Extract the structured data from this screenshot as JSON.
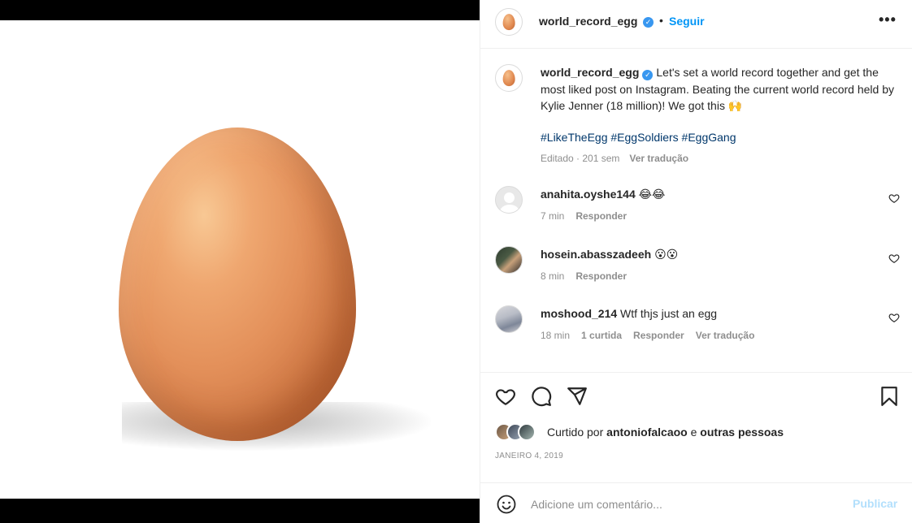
{
  "post": {
    "username": "world_record_egg",
    "follow_label": "Seguir",
    "separator": "•",
    "more_label": "•••"
  },
  "caption": {
    "username": "world_record_egg",
    "text": "Let's set a world record together and get the most liked post on Instagram. Beating the current world record held by Kylie Jenner (18 million)! We got this 🙌",
    "hashtags": "#LikeTheEgg #EggSoldiers #EggGang",
    "meta_time": "Editado · 201 sem",
    "translate_label": "Ver tradução"
  },
  "comments": [
    {
      "username": "anahita.oyshe144",
      "text": "😂😂",
      "time": "7 min",
      "replies": "",
      "reply_label": "Responder",
      "translate": ""
    },
    {
      "username": "hosein.abasszadeeh",
      "text": "😮😮",
      "time": "8 min",
      "replies": "",
      "reply_label": "Responder",
      "translate": ""
    },
    {
      "username": "moshood_214",
      "text": "Wtf thjs just an egg",
      "time": "18 min",
      "replies": "1 curtida",
      "reply_label": "Responder",
      "translate": "Ver tradução"
    }
  ],
  "likes": {
    "prefix": "Curtido por",
    "user": "antoniofalcaoo",
    "conjunction": "e",
    "others": "outras pessoas"
  },
  "date": "JANEIRO 4, 2019",
  "add_comment": {
    "placeholder": "Adicione um comentário...",
    "publish_label": "Publicar"
  },
  "colors": {
    "accent": "#0095f6",
    "verified": "#3897f0",
    "hashtag": "#00376b",
    "muted": "#8e8e8e",
    "publish_disabled": "#b2dffc"
  },
  "icons": [
    "verified-icon",
    "more-icon",
    "heart-icon",
    "comment-icon",
    "share-icon",
    "bookmark-icon",
    "emoji-icon"
  ]
}
